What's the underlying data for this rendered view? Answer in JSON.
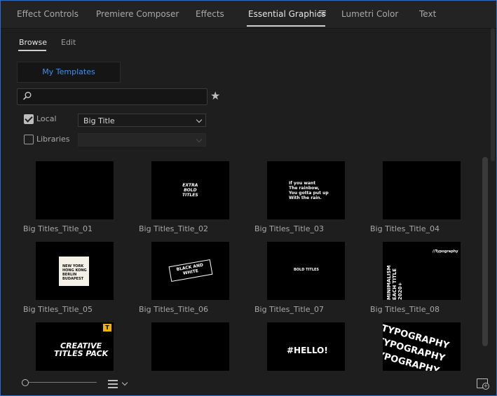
{
  "tabs": [
    {
      "label": "Effect Controls"
    },
    {
      "label": "Premiere Composer"
    },
    {
      "label": "Effects"
    },
    {
      "label": "Essential Graphics"
    },
    {
      "label": "Lumetri Color"
    },
    {
      "label": "Text"
    }
  ],
  "subtabs": [
    {
      "label": "Browse"
    },
    {
      "label": "Edit"
    }
  ],
  "templates_button": "My Templates",
  "search": {
    "value": "",
    "placeholder": ""
  },
  "filters": {
    "local": {
      "label": "Local",
      "checked": true
    },
    "libraries": {
      "label": "Libraries",
      "checked": false
    },
    "local_select": "Big Title",
    "libraries_select": ""
  },
  "templates": [
    {
      "label": "Big Titles_Title_01"
    },
    {
      "label": "Big Titles_Title_02",
      "art": "EXTRA\nBOLD\nTITLES"
    },
    {
      "label": "Big Titles_Title_03",
      "art": "If you want\nThe rainbow,\nYou gotta put up\nWith the rain."
    },
    {
      "label": "Big Titles_Title_04"
    },
    {
      "label": "Big Titles_Title_05",
      "art": "NEW YORK\nHONG KONG\nBERLIN\nBUDAPEST"
    },
    {
      "label": "Big Titles_Title_06",
      "art": "BLACK AND\nWHITE"
    },
    {
      "label": "Big Titles_Title_07",
      "art": "BOLD TITLES"
    },
    {
      "label": "Big Titles_Title_08",
      "art": "MINIMALISM\nEACH TITLE\n2020+",
      "art2": "//Typography"
    },
    {
      "art": "CREATIVE\nTITLES PACK",
      "badge": "T"
    },
    {},
    {
      "art": "#HELLO!"
    },
    {
      "art": "TYPOGRAPHY"
    }
  ],
  "colors": {
    "accent": "#3f90ee",
    "panel_border": "#2d6ecf",
    "badge": "#f0b400"
  }
}
